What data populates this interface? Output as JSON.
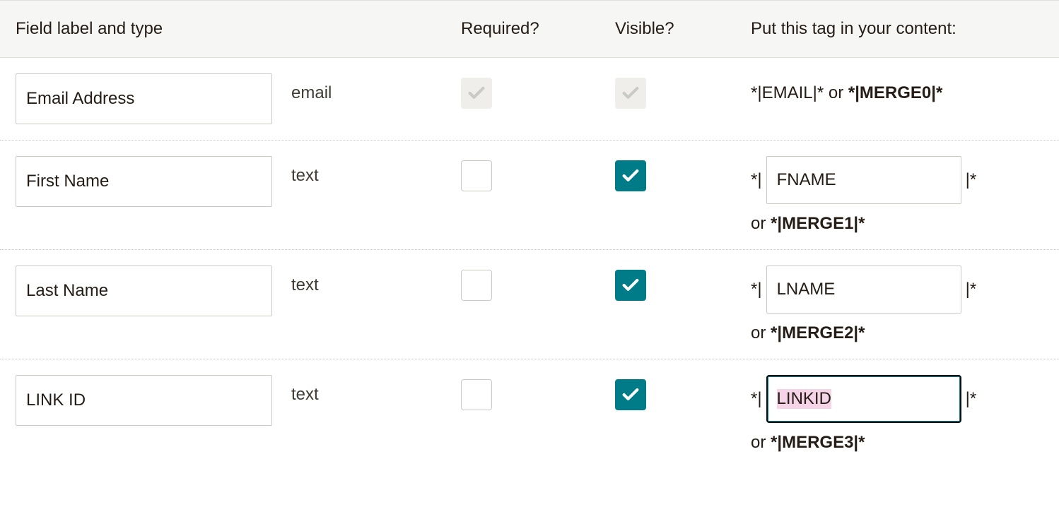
{
  "header": {
    "label": "Field label and type",
    "required": "Required?",
    "visible": "Visible?",
    "tag": "Put this tag in your content:"
  },
  "rows": [
    {
      "label": "Email Address",
      "type": "email",
      "required": {
        "checked": true,
        "disabled": true
      },
      "visible": {
        "checked": true,
        "disabled": true
      },
      "tag_kind": "static",
      "tag_prefix": "*|",
      "tag_value": "EMAIL",
      "tag_suffix": "|*",
      "or": "or",
      "merge_prefix": "*|",
      "merge": "MERGE0",
      "merge_suffix": "|*"
    },
    {
      "label": "First Name",
      "type": "text",
      "required": {
        "checked": false,
        "disabled": false
      },
      "visible": {
        "checked": true,
        "disabled": false
      },
      "tag_kind": "input",
      "tag_prefix": "*|",
      "tag_value": "FNAME",
      "tag_suffix": "|*",
      "or": "or",
      "merge_prefix": "*|",
      "merge": "MERGE1",
      "merge_suffix": "|*",
      "focused": false
    },
    {
      "label": "Last Name",
      "type": "text",
      "required": {
        "checked": false,
        "disabled": false
      },
      "visible": {
        "checked": true,
        "disabled": false
      },
      "tag_kind": "input",
      "tag_prefix": "*|",
      "tag_value": "LNAME",
      "tag_suffix": "|*",
      "or": "or",
      "merge_prefix": "*|",
      "merge": "MERGE2",
      "merge_suffix": "|*",
      "focused": false
    },
    {
      "label": "LINK ID",
      "type": "text",
      "required": {
        "checked": false,
        "disabled": false
      },
      "visible": {
        "checked": true,
        "disabled": false
      },
      "tag_kind": "input",
      "tag_prefix": "*|",
      "tag_value": "LINKID",
      "tag_suffix": "|*",
      "or": "or",
      "merge_prefix": "*|",
      "merge": "MERGE3",
      "merge_suffix": "|*",
      "focused": true
    }
  ]
}
